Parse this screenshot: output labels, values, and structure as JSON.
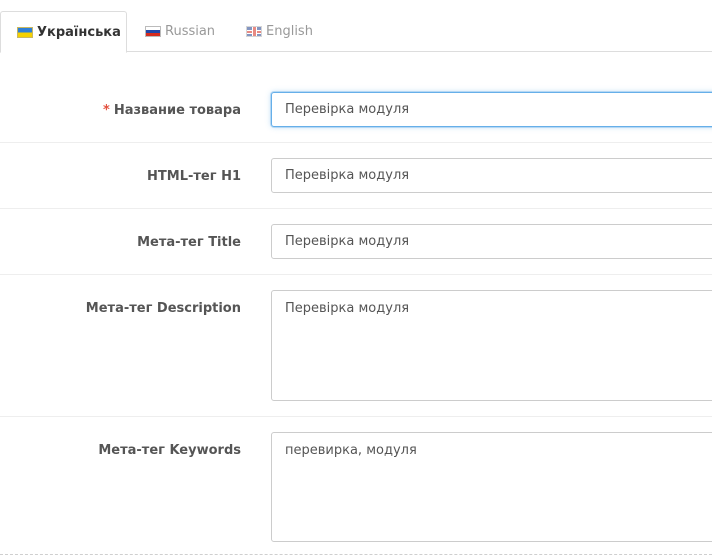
{
  "tabs": [
    {
      "label": "Українська",
      "flag": "flag-ukraine-icon",
      "active": true
    },
    {
      "label": "Russian",
      "flag": "flag-russia-icon",
      "active": false
    },
    {
      "label": "English",
      "flag": "flag-uk-icon",
      "active": false
    }
  ],
  "form": {
    "product_name": {
      "label": "Название товара",
      "required_mark": "*",
      "value": "Перевірка модуля"
    },
    "h1": {
      "label": "HTML-тег H1",
      "value": "Перевірка модуля"
    },
    "meta_title": {
      "label": "Мета-тег Title",
      "value": "Перевірка модуля"
    },
    "meta_description": {
      "label": "Мета-тег Description",
      "value": "Перевірка модуля"
    },
    "meta_keywords": {
      "label": "Мета-тег Keywords",
      "value": "перевирка, модуля"
    }
  },
  "colors": {
    "required": "#e3503e",
    "focus_border": "#66afe9",
    "border": "#cccccc",
    "label": "#555555"
  }
}
